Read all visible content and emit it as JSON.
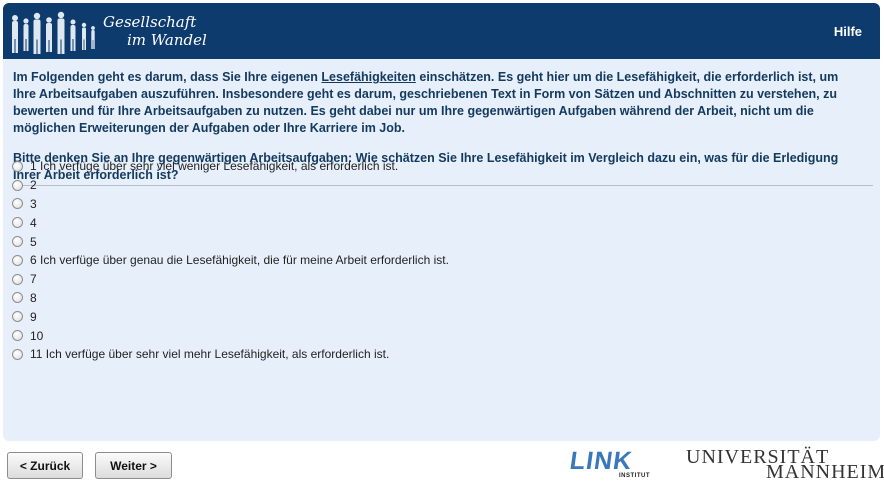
{
  "header": {
    "logo_line1": "Gesellschaft",
    "logo_line2": "im Wandel",
    "help_link": "Hilfe"
  },
  "intro": {
    "part1": "Im Folgenden geht es darum, dass Sie Ihre eigenen ",
    "link_term": "Lesefähigkeiten",
    "part2": " einschätzen. Es geht hier um die Lesefähigkeit, die erforderlich ist, um Ihre Arbeitsaufgaben auszuführen. Insbesondere geht es darum, geschriebenen Text in Form von Sätzen und Abschnitten zu verstehen, zu bewerten und für Ihre Arbeitsaufgaben zu nutzen. Es geht dabei nur um Ihre gegenwärtigen Aufgaben während der Arbeit, nicht um die möglichen Erweiterungen der Aufgaben oder Ihre Karriere im Job."
  },
  "question": "Bitte denken Sie an Ihre gegenwärtigen Arbeitsaufgaben: Wie schätzen Sie Ihre Lesefähigkeit im Vergleich dazu ein, was für die Erledigung Ihrer Arbeit erforderlich ist?",
  "options": [
    "1 Ich verfüge über sehr viel weniger Lesefähigkeit, als erforderlich ist.",
    "2",
    "3",
    "4",
    "5",
    "6 Ich verfüge über genau die Lesefähigkeit, die für meine Arbeit erforderlich ist.",
    "7",
    "8",
    "9",
    "10",
    "11 Ich verfüge über sehr viel mehr Lesefähigkeit, als erforderlich ist."
  ],
  "buttons": {
    "back": "< Zurück",
    "next": "Weiter >"
  },
  "logos": {
    "link_main": "LINK",
    "link_sub": "INSTITUT",
    "uni_line1": "UNIVERSITÄT",
    "uni_line2": "MANNHEIM"
  },
  "colors": {
    "header_bg": "#0d3b6e",
    "panel_bg": "#e7f0fa",
    "text_primary": "#143a60",
    "link_blue": "#3a78bc"
  }
}
